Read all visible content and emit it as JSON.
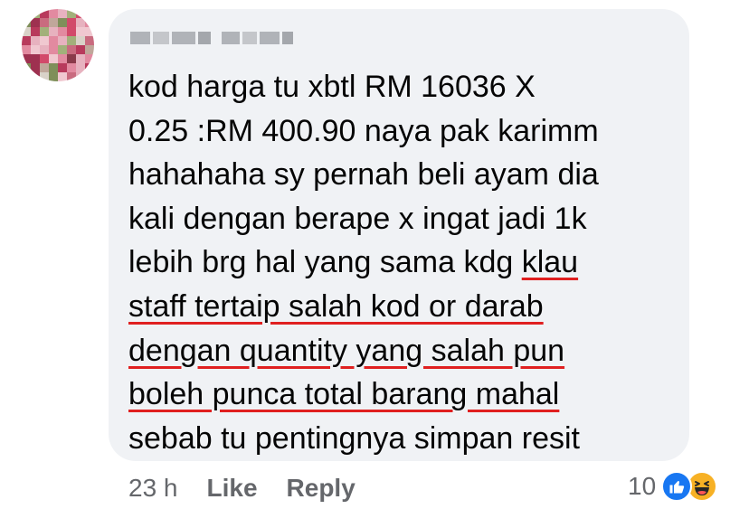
{
  "comment": {
    "lines": [
      "kod harga tu xbtl RM 16036 X",
      "0.25 :RM 400.90 naya pak karimm",
      "hahahaha sy pernah beli ayam dia",
      "kali dengan berape x ingat jadi 1k",
      "lebih brg hal yang sama kdg ",
      "klau",
      "staff tertaip salah kod or darab",
      "dengan quantity yang salah pun",
      "boleh punca total barang mahal",
      "sebab tu pentingnya simpan resit"
    ]
  },
  "footer": {
    "time": "23 h",
    "like_label": "Like",
    "reply_label": "Reply"
  },
  "reactions": {
    "count": "10",
    "icons": [
      "like-icon",
      "haha-icon"
    ]
  },
  "colors": {
    "bubble": "#f0f2f5",
    "text": "#050505",
    "meta": "#65676b",
    "underline": "#e02020",
    "like": "#1877f2",
    "haha": "#f7b125"
  }
}
